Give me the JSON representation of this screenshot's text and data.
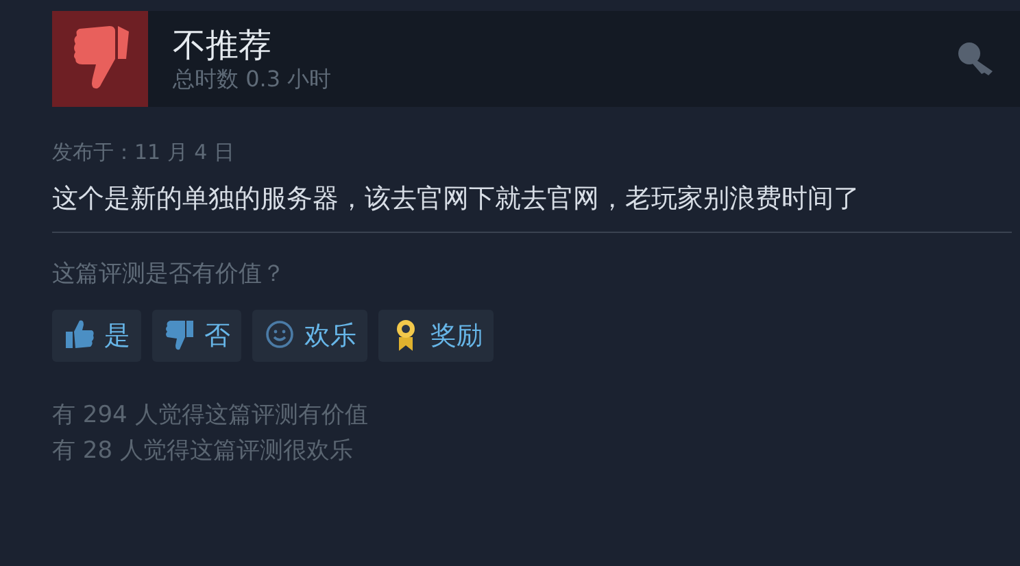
{
  "review": {
    "verdict": "不推荐",
    "playtime": "总时数 0.3 小时",
    "posted": "发布于：11 月 4 日",
    "text": "这个是新的单独的服务器，该去官网下就去官网，老玩家别浪费时间了"
  },
  "helpful_prompt": "这篇评测是否有价值？",
  "buttons": [
    {
      "kind": "up",
      "label": "是"
    },
    {
      "kind": "down",
      "label": "否"
    },
    {
      "kind": "funny",
      "label": "欢乐"
    },
    {
      "kind": "award",
      "label": "奖励"
    }
  ],
  "stats": [
    "有 294 人觉得这篇评测有价值",
    "有 28 人觉得这篇评测很欢乐"
  ]
}
